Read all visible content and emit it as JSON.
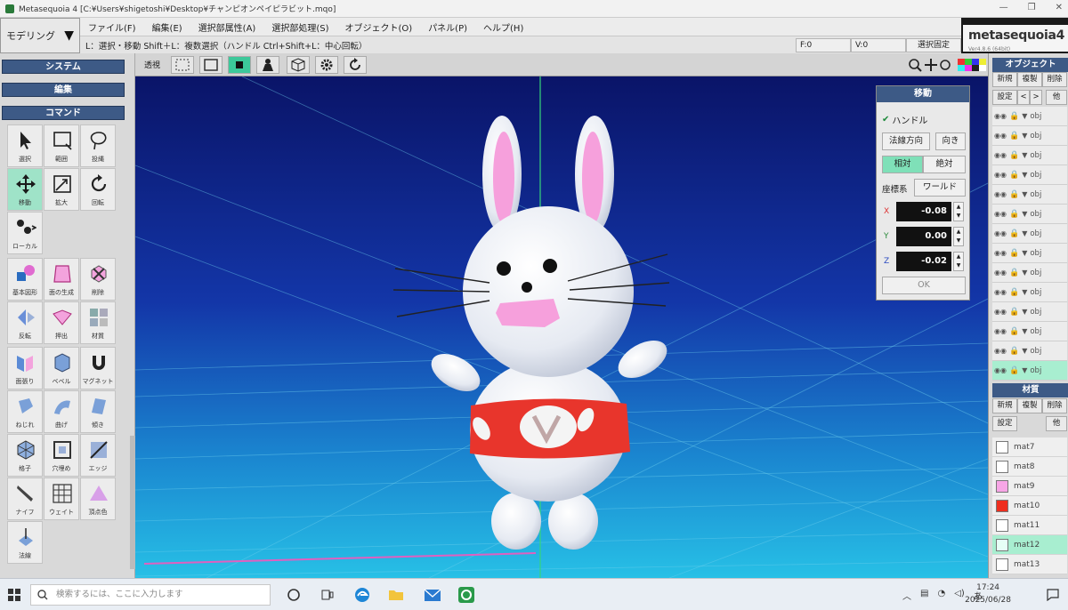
{
  "window": {
    "title": "Metasequoia 4 [C:¥Users¥shigetoshi¥Desktop¥チャンピオンペイピラビット.mqo]"
  },
  "mode": {
    "selected": "モデリング"
  },
  "menu": [
    "ファイル(F)",
    "編集(E)",
    "選択部属性(A)",
    "選択部処理(S)",
    "オブジェクト(O)",
    "パネル(P)",
    "ヘルプ(H)"
  ],
  "hint": {
    "text": "L：選択・移動  Shift＋L：複数選択（ハンドル  Ctrl+Shift+L：中心回転）",
    "face_count": "F:0",
    "vertex_count": "V:0",
    "lock_label": "選択固定"
  },
  "logo": {
    "name": "metasequoia4",
    "version": "Ver4.8.6 (64bit)"
  },
  "left": {
    "sections": {
      "system": "システム",
      "edit": "編集",
      "command": "コマンド"
    },
    "tools": [
      "選択",
      "範囲",
      "投縄",
      "移動",
      "拡大",
      "回転",
      "ローカル",
      "基本図形",
      "面の生成",
      "削除",
      "反転",
      "押出",
      "材質",
      "面張り",
      "ベベル",
      "マグネット",
      "ねじれ",
      "曲げ",
      "傾き",
      "格子",
      "穴埋め",
      "エッジ",
      "ナイフ",
      "ウェイト",
      "頂点色",
      "法線"
    ]
  },
  "viewport": {
    "perspective_label": "透視"
  },
  "move_dialog": {
    "title": "移動",
    "handle_label": "ハンドル",
    "normal_dir": "法線方向",
    "orient": "向き",
    "relative": "相対",
    "absolute": "絶対",
    "coord_label": "座標系",
    "coord_value": "ワールド",
    "x_label": "X",
    "y_label": "Y",
    "z_label": "Z",
    "x": "-0.08",
    "y": "0.00",
    "z": "-0.02",
    "ok": "OK"
  },
  "object_panel": {
    "title": "オブジェクト",
    "new": "新規",
    "copy": "複製",
    "delete": "削除",
    "settings": "設定",
    "prev": "<",
    "next": ">",
    "other": "他",
    "items": [
      "obj",
      "obj",
      "obj",
      "obj",
      "obj",
      "obj",
      "obj",
      "obj",
      "obj",
      "obj",
      "obj",
      "obj",
      "obj",
      "obj"
    ]
  },
  "material_panel": {
    "title": "材質",
    "new": "新規",
    "copy": "複製",
    "delete": "削除",
    "settings": "設定",
    "other": "他",
    "items": [
      {
        "name": "mat7",
        "color": "#ffffff"
      },
      {
        "name": "mat8",
        "color": "#ffffff"
      },
      {
        "name": "mat9",
        "color": "#f7a6e6"
      },
      {
        "name": "mat10",
        "color": "#ee2f1f"
      },
      {
        "name": "mat11",
        "color": "#ffffff"
      },
      {
        "name": "mat12",
        "color": "#e6fff6"
      },
      {
        "name": "mat13",
        "color": "#ffffff"
      }
    ]
  },
  "taskbar": {
    "search_placeholder": "検索するには、ここに入力します",
    "time": "17:24",
    "date": "2025/06/28"
  },
  "colors": {
    "accent": "#3cc89a",
    "panel_header": "#3d5a86",
    "viewport_top": "#0a1a6e",
    "viewport_bottom": "#1faad6"
  }
}
